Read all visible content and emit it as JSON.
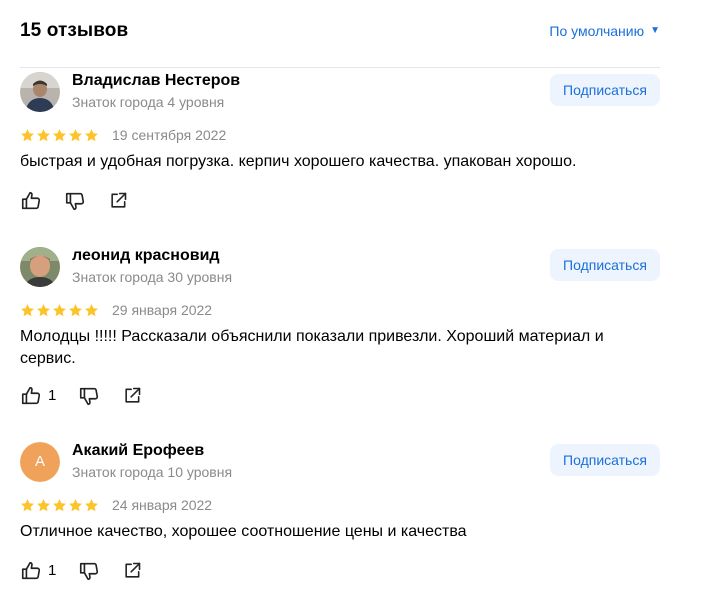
{
  "header": {
    "title": "15 отзывов",
    "sort_label": "По умолчанию"
  },
  "colors": {
    "accent": "#1a6fdc",
    "star": "#fdc32b",
    "muted_text": "#8a8a8a",
    "subscribe_bg": "#eef4fd",
    "avatar_letter_bg": "#f0a15a"
  },
  "reviews": [
    {
      "author": "Владислав Нестеров",
      "level": "Знаток города 4 уровня",
      "subscribe_label": "Подписаться",
      "rating": 5,
      "date": "19 сентября 2022",
      "text": "быстрая и удобная погрузка. керпич хорошего качества. упакован хорошо.",
      "likes": "",
      "avatar": "photo"
    },
    {
      "author": "леонид красновид",
      "level": "Знаток города 30 уровня",
      "subscribe_label": "Подписаться",
      "rating": 5,
      "date": "29 января 2022",
      "text": "Молодцы !!!!! Рассказали объяснили показали привезли. Хороший материал и сервис.",
      "likes": "1",
      "avatar": "photo"
    },
    {
      "author": "Акакий Ерофеев",
      "level": "Знаток города 10 уровня",
      "subscribe_label": "Подписаться",
      "rating": 5,
      "date": "24 января 2022",
      "text": "Отличное качество, хорошее соотношение цены и качества",
      "likes": "1",
      "avatar": "letter",
      "avatar_letter": "А"
    }
  ],
  "icons": {
    "like": "thumbs-up-icon",
    "dislike": "thumbs-down-icon",
    "share": "share-icon",
    "sort_caret": "caret-down-icon"
  }
}
